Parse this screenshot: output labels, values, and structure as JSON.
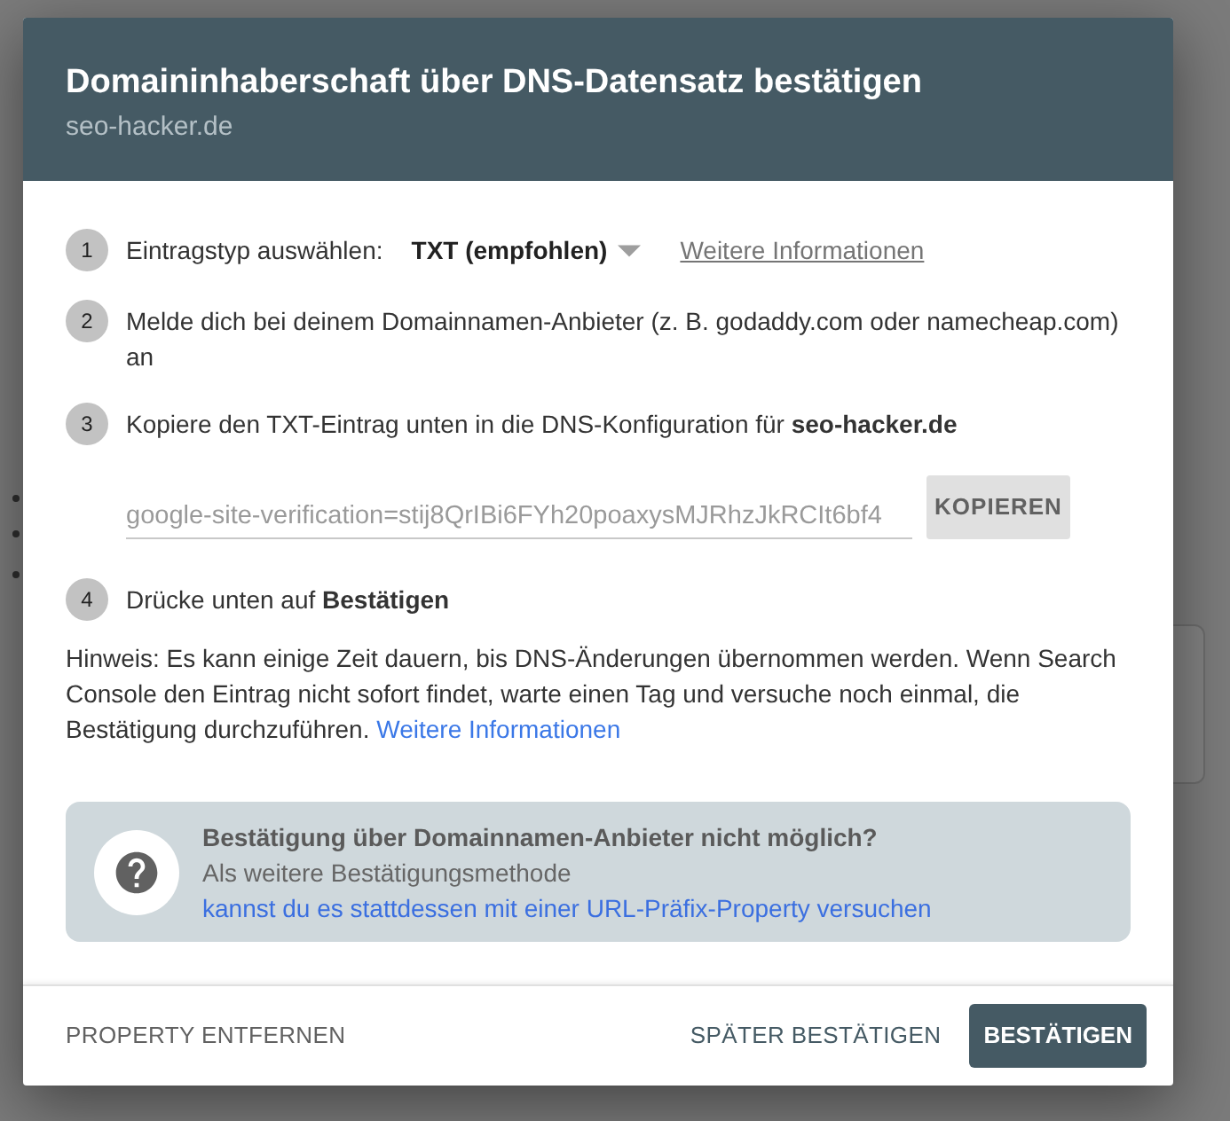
{
  "dialog": {
    "title": "Domaininhaberschaft über DNS-Datensatz bestätigen",
    "subtitle": "seo-hacker.de",
    "steps": [
      {
        "number": "1",
        "kind": "select",
        "label": "Eintragstyp auswählen:",
        "select_value": "TXT (empfohlen)",
        "link": "Weitere Informationen"
      },
      {
        "number": "2",
        "kind": "text",
        "text": "Melde dich bei deinem Domainnamen-Anbieter (z. B. godaddy.com oder namecheap.com) an"
      },
      {
        "number": "3",
        "kind": "copy",
        "text": "Kopiere den TXT-Eintrag unten in die DNS-Konfiguration für **seo-hacker.de**",
        "field_value": "google-site-verification=stij8QrIBi6FYh20poaxysMJRhzJkRCIt6bf4",
        "button": "KOPIEREN"
      },
      {
        "number": "4",
        "kind": "text",
        "text": "Drücke unten auf **Bestätigen**"
      }
    ],
    "note": {
      "text": "Hinweis: Es kann einige Zeit dauern, bis DNS-Änderungen übernommen werden. Wenn Search Console den Eintrag nicht sofort findet, warte einen Tag und versuche noch einmal, die Bestätigung durchzuführen.",
      "link": "Weitere Informationen"
    },
    "alternative": {
      "title": "Bestätigung über Domainnamen-Anbieter nicht möglich?",
      "text": "Als weitere Bestätigungsmethode",
      "link": "kannst du es stattdessen mit einer URL-Präfix-Property versuchen"
    },
    "footer": {
      "remove_button": "PROPERTY ENTFERNEN",
      "later_button": "SPÄTER BESTÄTIGEN",
      "confirm_button": "BESTÄTIGEN"
    }
  }
}
